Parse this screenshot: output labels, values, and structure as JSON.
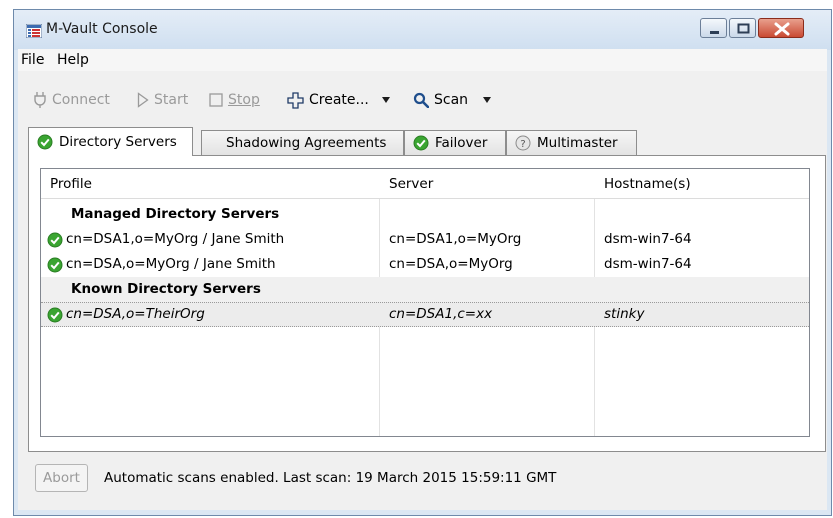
{
  "window": {
    "title": "M-Vault Console",
    "app_icon": "grid-app-icon"
  },
  "menu": {
    "file": "File",
    "help": "Help"
  },
  "toolbar": {
    "connect": "Connect",
    "start": "Start",
    "stop": "Stop",
    "create": "Create...",
    "scan": "Scan"
  },
  "tabs": [
    {
      "label": "Directory Servers",
      "status": "ok",
      "active": true
    },
    {
      "label": "Shadowing Agreements"
    },
    {
      "label": "Failover",
      "status": "ok"
    },
    {
      "label": "Multimaster",
      "status": "unknown"
    }
  ],
  "table": {
    "columns": [
      "Profile",
      "Server",
      "Hostname(s)"
    ],
    "rows": [
      {
        "type": "group",
        "profile": "Managed Directory Servers"
      },
      {
        "type": "item",
        "profile": "cn=DSA1,o=MyOrg / Jane Smith",
        "server": "cn=DSA1,o=MyOrg",
        "host": "dsm-win7-64"
      },
      {
        "type": "item",
        "profile": "cn=DSA,o=MyOrg / Jane Smith",
        "server": "cn=DSA,o=MyOrg",
        "host": "dsm-win7-64"
      },
      {
        "type": "group",
        "profile": "Known Directory Servers"
      },
      {
        "type": "item",
        "profile": "cn=DSA,o=TheirOrg",
        "server": "cn=DSA1,c=xx",
        "host": "stinky"
      }
    ]
  },
  "statusbar": {
    "abort": "Abort",
    "message": "Automatic scans enabled. Last scan: 19 March 2015 15:59:11 GMT"
  },
  "colors": {
    "ok_green": "#3aa531",
    "accent_blue": "#1f4e8c"
  }
}
